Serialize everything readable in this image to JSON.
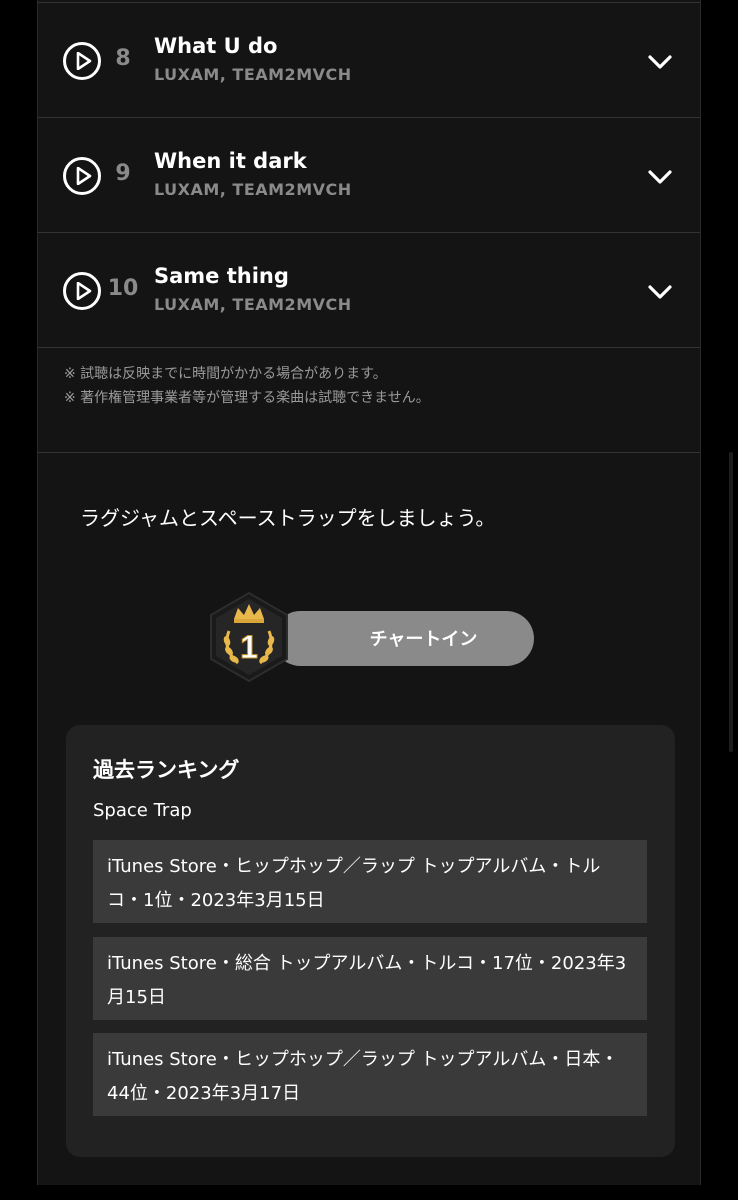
{
  "tracks": [
    {
      "number": "8",
      "title": "What U do",
      "artist": "LUXAM, TEAM2MVCH"
    },
    {
      "number": "9",
      "title": "When it dark",
      "artist": "LUXAM, TEAM2MVCH"
    },
    {
      "number": "10",
      "title": "Same thing",
      "artist": "LUXAM, TEAM2MVCH"
    }
  ],
  "notes": [
    "※ 試聴は反映までに時間がかかる場合があります。",
    "※ 著作権管理事業者等が管理する楽曲は試聴できません。"
  ],
  "tagline": "ラグジャムとスペーストラップをしましょう。",
  "chart_button": {
    "label": "チャートイン",
    "badge_rank": "1"
  },
  "ranking": {
    "title": "過去ランキング",
    "album": "Space Trap",
    "items": [
      "iTunes Store・ヒップホップ／ラップ トップアルバム・トルコ・1位・2023年3月15日",
      "iTunes Store・総合 トップアルバム・トルコ・17位・2023年3月15日",
      "iTunes Store・ヒップホップ／ラップ トップアルバム・日本・44位・2023年3月17日"
    ]
  },
  "colors": {
    "background": "#000000",
    "card": "#141414",
    "muted_text": "#8a8a8a",
    "gold": "#e8b84a"
  }
}
